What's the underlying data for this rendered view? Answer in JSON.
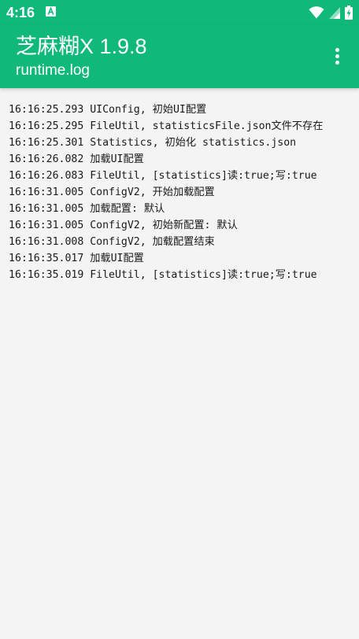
{
  "status_bar": {
    "time": "4:16",
    "notification_icon": "a-square-icon",
    "wifi_icon": "wifi-icon",
    "signal_icon": "cell-signal-icon",
    "battery_icon": "battery-charging-icon"
  },
  "app_bar": {
    "title": "芝麻糊X 1.9.8",
    "subtitle": "runtime.log",
    "menu_icon": "more-vert-icon",
    "background_color": "#10b97a"
  },
  "log": {
    "lines": [
      "16:16:25.293 UIConfig, 初始UI配置",
      "16:16:25.295 FileUtil, statisticsFile.json文件不存在",
      "16:16:25.301 Statistics, 初始化 statistics.json",
      "16:16:26.082 加载UI配置",
      "16:16:26.083 FileUtil, [statistics]读:true;写:true",
      "16:16:31.005 ConfigV2, 开始加载配置",
      "16:16:31.005 加载配置: 默认",
      "16:16:31.005 ConfigV2, 初始新配置: 默认",
      "16:16:31.008 ConfigV2, 加载配置结束",
      "16:16:35.017 加载UI配置",
      "16:16:35.019 FileUtil, [statistics]读:true;写:true"
    ]
  }
}
